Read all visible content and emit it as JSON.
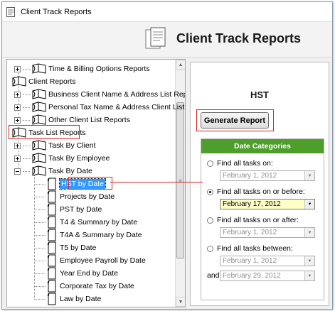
{
  "window": {
    "title": "Client Track Reports"
  },
  "header": {
    "heading": "Client Track Reports"
  },
  "tree": {
    "items": [
      {
        "label": "Time & Billing Options Reports",
        "level": 1,
        "expander": "plus"
      },
      {
        "label": "Client Reports",
        "level": 0,
        "expander": "none"
      },
      {
        "label": "Business Client Name & Address List Reports",
        "level": 1,
        "expander": "plus"
      },
      {
        "label": "Personal Tax Name & Address Client List Re",
        "level": 1,
        "expander": "plus"
      },
      {
        "label": "Other Client List Reports",
        "level": 1,
        "expander": "plus"
      },
      {
        "label": "Task List Reports",
        "level": 0,
        "expander": "none"
      },
      {
        "label": "Task By Client",
        "level": 1,
        "expander": "plus"
      },
      {
        "label": "Task By Employee",
        "level": 1,
        "expander": "plus"
      },
      {
        "label": "Task By Date",
        "level": 1,
        "expander": "minus"
      },
      {
        "label": "HST by Date",
        "level": 2,
        "selected": true
      },
      {
        "label": "Projects by Date",
        "level": 2
      },
      {
        "label": "PST by Date",
        "level": 2
      },
      {
        "label": "T4 & Summary by Date",
        "level": 2
      },
      {
        "label": "T4A & Summary by Date",
        "level": 2
      },
      {
        "label": "T5 by Date",
        "level": 2
      },
      {
        "label": "Employee Payroll by Date",
        "level": 2
      },
      {
        "label": "Year End by Date",
        "level": 2
      },
      {
        "label": "Corporate Tax by Date",
        "level": 2
      },
      {
        "label": "Law by Date",
        "level": 2
      }
    ]
  },
  "report": {
    "title": "HST",
    "generate_label": "Generate Report"
  },
  "date_categories": {
    "header": "Date Categories",
    "options": [
      {
        "label": "Find all tasks on:",
        "checked": false,
        "value": "February 1, 2012"
      },
      {
        "label": "Find all tasks on or before:",
        "checked": true,
        "value": "February 17, 2012"
      },
      {
        "label": "Find all tasks on or after:",
        "checked": false,
        "value": "February 1, 2012"
      },
      {
        "label": "Find all tasks between:",
        "checked": false,
        "value": "February 1, 2012"
      }
    ],
    "and_label": "and",
    "and_value": "February 29, 2012"
  },
  "colors": {
    "accent_green": "#4d9e2a",
    "highlight_red": "#e02020",
    "selection_blue": "#3399ff",
    "active_field": "#ffffc8"
  }
}
